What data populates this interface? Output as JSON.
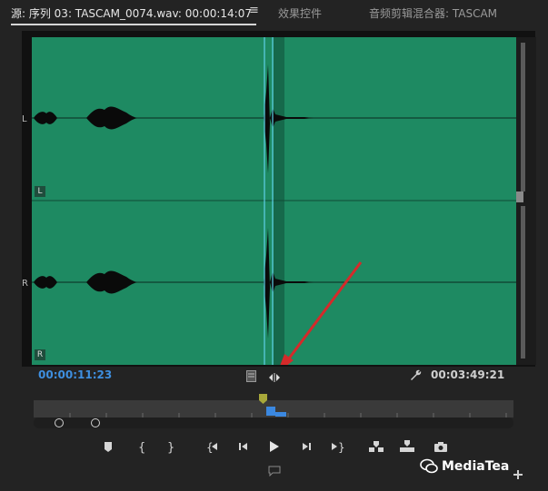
{
  "tabs": {
    "source": "源: 序列 03: TASCAM_0074.wav: 00:00:14:07",
    "menu_icon": "≡",
    "effects": "效果控件",
    "mixer": "音频剪辑混合器: TASCAM"
  },
  "channels": {
    "left_label": "L",
    "right_label": "R",
    "left_badge": "L",
    "right_badge": "R"
  },
  "timecodes": {
    "current": "00:00:11:23",
    "duration": "00:03:49:21"
  },
  "icons": {
    "tab_menu": "hamburger-icon",
    "drag_video": "film-icon",
    "drag_audio": "audio-drag-icon",
    "settings": "wrench-icon",
    "add_marker": "marker-icon",
    "mark_in": "mark-in-icon",
    "mark_out": "mark-out-icon",
    "go_to_in": "go-to-in-icon",
    "step_back": "step-back-icon",
    "play": "play-icon",
    "step_forward": "step-forward-icon",
    "go_to_out": "go-to-out-icon",
    "insert": "insert-icon",
    "overwrite": "overwrite-icon",
    "export_frame": "camera-icon",
    "comment": "comment-icon",
    "add_button": "plus-icon",
    "watermark_logo": "wechat-icon"
  },
  "colors": {
    "waveform_bg": "#1e8a62",
    "playhead": "#5fd0e8",
    "timecode_current": "#3e8fe0",
    "annotation_arrow": "#d42a2a"
  },
  "watermark": "MediaTea"
}
